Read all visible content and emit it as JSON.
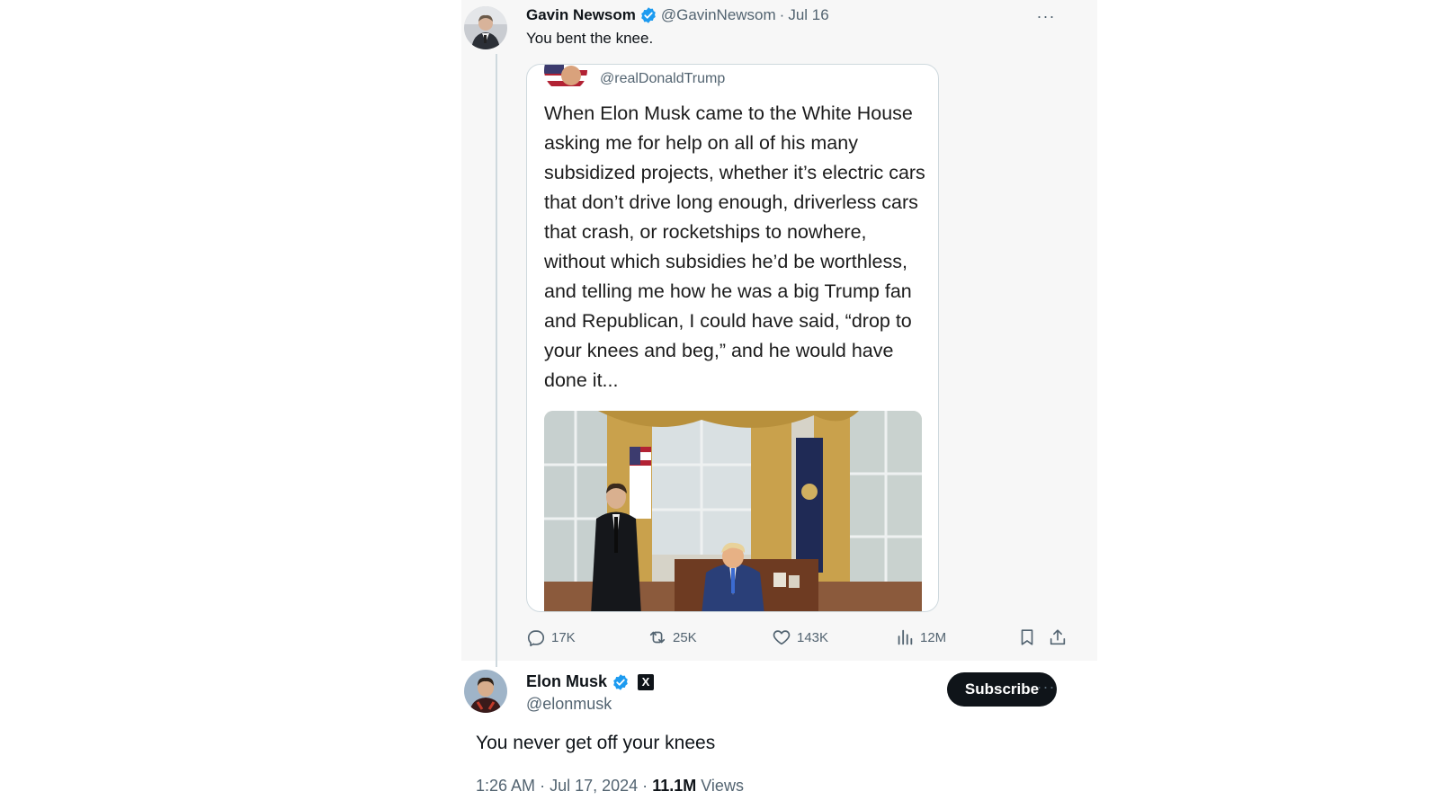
{
  "parent_tweet": {
    "author_name": "Gavin Newsom",
    "handle": "@GavinNewsom",
    "separator": "·",
    "date": "Jul 16",
    "text": "You bent the knee.",
    "more_label": "···",
    "quote": {
      "handle": "@realDonaldTrump",
      "text": "When Elon Musk came to the White House asking me for help on all of his many subsidized projects, whether it’s electric cars that don’t drive long enough, driverless cars that crash, or rocketships to nowhere, without which subsidies he’d be worthless, and telling me how he was a big Trump fan and Republican, I could have said, “drop to your knees and beg,” and he would have done it..."
    },
    "stats": {
      "replies": "17K",
      "reposts": "25K",
      "likes": "143K",
      "views": "12M"
    }
  },
  "reply_tweet": {
    "author_name": "Elon Musk",
    "badge_letter": "X",
    "handle": "@elonmusk",
    "subscribe_label": "Subscribe",
    "more_label": "···",
    "text": "You never get off your knees",
    "time": "1:26 AM",
    "separator": "·",
    "date": "Jul 17, 2024",
    "views_count": "11.1M",
    "views_label": "Views"
  },
  "colors": {
    "verified_blue": "#1d9bf0",
    "text_primary": "#0f1419",
    "text_muted": "#536471",
    "parent_background": "#f7f7f7"
  },
  "icons": [
    "verified-badge-icon",
    "more-icon",
    "reply-icon",
    "repost-icon",
    "like-icon",
    "views-icon",
    "bookmark-icon",
    "share-icon"
  ]
}
